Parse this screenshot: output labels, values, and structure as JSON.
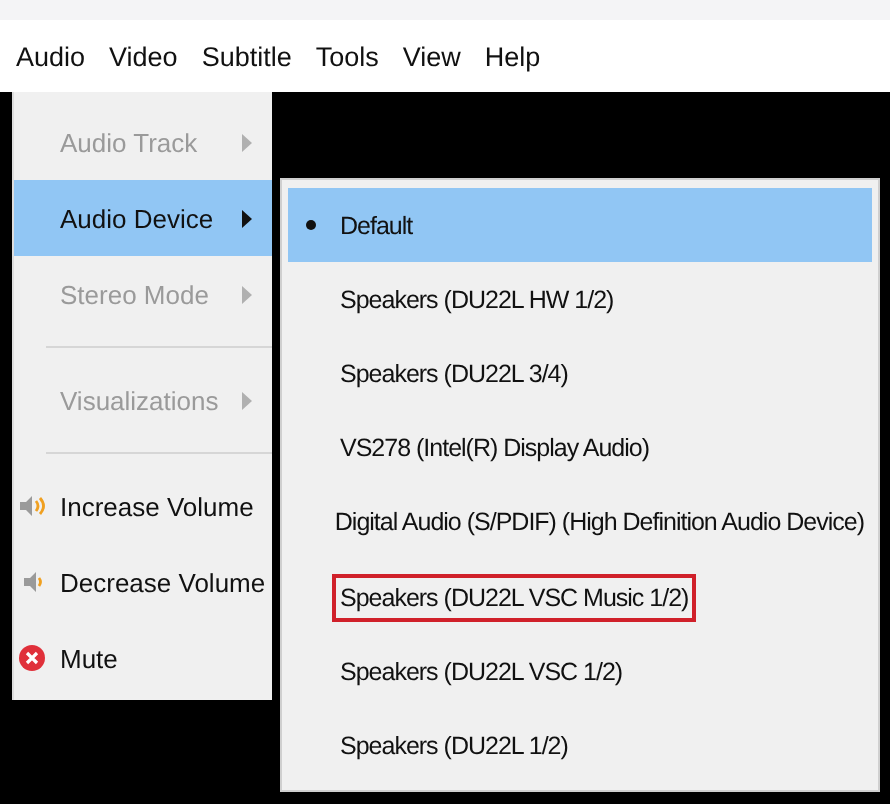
{
  "menubar": [
    {
      "label": "Audio"
    },
    {
      "label": "Video"
    },
    {
      "label": "Subtitle"
    },
    {
      "label": "Tools"
    },
    {
      "label": "View"
    },
    {
      "label": "Help"
    }
  ],
  "audio_menu": [
    {
      "kind": "submenu",
      "label": "Audio Track",
      "disabled": true,
      "selected": false
    },
    {
      "kind": "submenu",
      "label": "Audio Device",
      "disabled": false,
      "selected": true
    },
    {
      "kind": "submenu",
      "label": "Stereo Mode",
      "disabled": true,
      "selected": false
    },
    {
      "kind": "separator"
    },
    {
      "kind": "submenu",
      "label": "Visualizations",
      "disabled": true,
      "selected": false
    },
    {
      "kind": "separator"
    },
    {
      "kind": "louder",
      "label": "Increase Volume",
      "disabled": false,
      "selected": false
    },
    {
      "kind": "quieter",
      "label": "Decrease Volume",
      "disabled": false,
      "selected": false
    },
    {
      "kind": "mute",
      "label": "Mute",
      "disabled": false,
      "selected": false
    }
  ],
  "audio_device_menu": [
    {
      "label": "Default",
      "checked": true,
      "selected": true,
      "outlined": false
    },
    {
      "label": "Speakers (DU22L HW 1/2)",
      "checked": false,
      "selected": false,
      "outlined": false
    },
    {
      "label": "Speakers (DU22L 3/4)",
      "checked": false,
      "selected": false,
      "outlined": false
    },
    {
      "label": "VS278 (Intel(R) Display Audio)",
      "checked": false,
      "selected": false,
      "outlined": false
    },
    {
      "label": "Digital Audio (S/PDIF) (High Definition Audio Device)",
      "checked": false,
      "selected": false,
      "outlined": false
    },
    {
      "label": "Speakers (DU22L VSC Music 1/2)",
      "checked": false,
      "selected": false,
      "outlined": true
    },
    {
      "label": "Speakers (DU22L VSC 1/2)",
      "checked": false,
      "selected": false,
      "outlined": false
    },
    {
      "label": "Speakers (DU22L 1/2)",
      "checked": false,
      "selected": false,
      "outlined": false
    }
  ]
}
